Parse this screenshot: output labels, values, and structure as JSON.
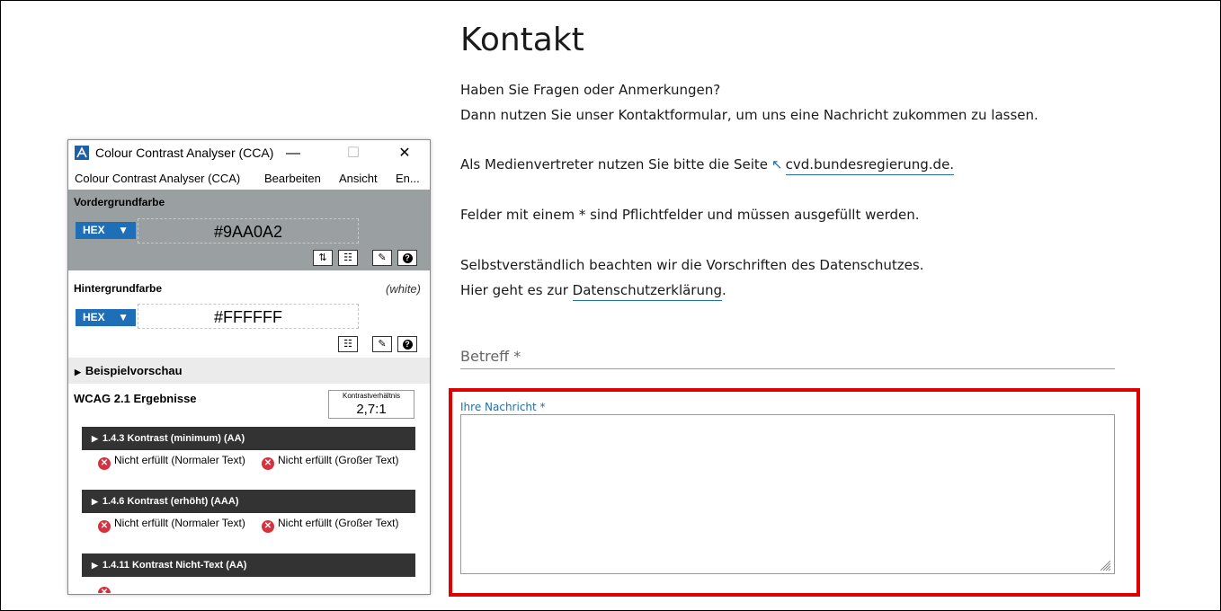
{
  "page": {
    "title": "Kontakt",
    "intro_line1": "Haben Sie Fragen oder Anmerkungen?",
    "intro_line2": "Dann nutzen Sie unser Kontaktformular, um uns eine Nachricht zukommen zu lassen.",
    "media_text": "Als Medienvertreter nutzen Sie bitte die Seite",
    "media_link": "cvd.bundesregierung.de.",
    "required_note": "Felder mit einem * sind Pflichtfelder und müssen ausgefüllt werden.",
    "privacy_line1": "Selbstverständlich beachten wir die Vorschriften des Datenschutzes.",
    "privacy_line2_prefix": "Hier geht es zur",
    "privacy_link": "Datenschutzerklärung",
    "privacy_line2_suffix": ".",
    "subject_label": "Betreff *",
    "message_label": "Ihre Nachricht *",
    "message_value": "",
    "highlight_color": "#e00000",
    "link_color": "#1f6fad"
  },
  "cca": {
    "window_title": "Colour Contrast Analyser (CCA)",
    "minimize_label": "—",
    "maximize_label": "☐",
    "close_label": "✕",
    "menu": [
      "Colour Contrast Analyser (CCA)",
      "Bearbeiten",
      "Ansicht",
      "En..."
    ],
    "foreground": {
      "label": "Vordergrundfarbe",
      "format": "HEX",
      "value": "#9AA0A2",
      "panel_color": "#9aa0a2"
    },
    "background": {
      "label": "Hintergrundfarbe",
      "note": "(white)",
      "format": "HEX",
      "value": "#FFFFFF"
    },
    "preview_label": "Beispielvorschau",
    "results_label": "WCAG 2.1 Ergebnisse",
    "ratio_caption": "Kontrastverhältnis",
    "ratio_value": "2,7:1",
    "criteria": [
      {
        "title": "1.4.3 Kontrast (minimum) (AA)",
        "normal": "Nicht erfüllt (Normaler Text)",
        "large": "Nicht erfüllt (Großer Text)"
      },
      {
        "title": "1.4.6 Kontrast (erhöht) (AAA)",
        "normal": "Nicht erfüllt (Normaler Text)",
        "large": "Nicht erfüllt (Großer Text)"
      },
      {
        "title": "1.4.11 Kontrast Nicht-Text (AA)"
      }
    ],
    "icons": {
      "app": "cca-app-icon",
      "swap": "swap-icon",
      "sliders": "sliders-icon",
      "eyedropper": "eyedropper-icon",
      "help": "help-icon",
      "fail": "fail-icon",
      "expand": "triangle-right-icon"
    }
  }
}
